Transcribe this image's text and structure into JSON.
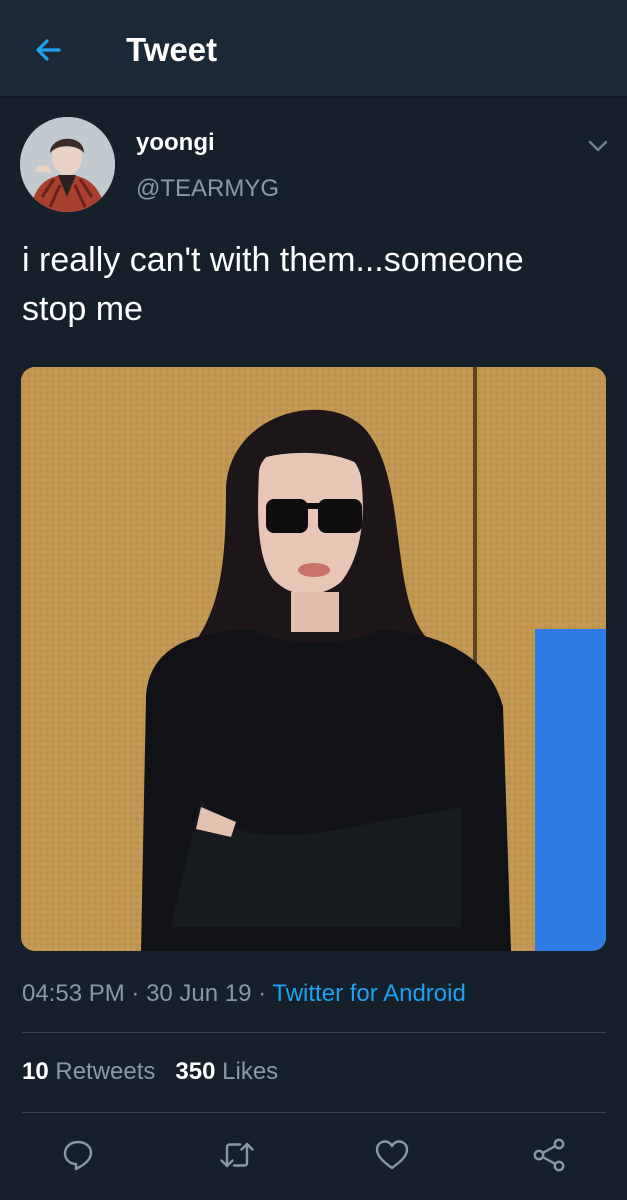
{
  "header": {
    "title": "Tweet",
    "back_icon": "arrow-left-icon",
    "accent_color": "#1da1f2"
  },
  "author": {
    "display_name": "yoongi",
    "handle": "@TEARMYG"
  },
  "tweet": {
    "text": "i really can't with them...someone\nstop me",
    "time": "04:53 PM",
    "sep1": " · ",
    "date": "30 Jun 19",
    "sep2": " · ",
    "source": "Twitter for Android"
  },
  "stats": {
    "retweets_count": "10",
    "retweets_label": "Retweets",
    "likes_count": "350",
    "likes_label": "Likes"
  },
  "actions": {
    "reply_icon": "reply-icon",
    "retweet_icon": "retweet-icon",
    "like_icon": "heart-icon",
    "share_icon": "share-icon"
  },
  "theme": {
    "background": "#15202b",
    "header_background": "#1b2836",
    "secondary_text": "#8899a6",
    "divider": "#38444d"
  }
}
